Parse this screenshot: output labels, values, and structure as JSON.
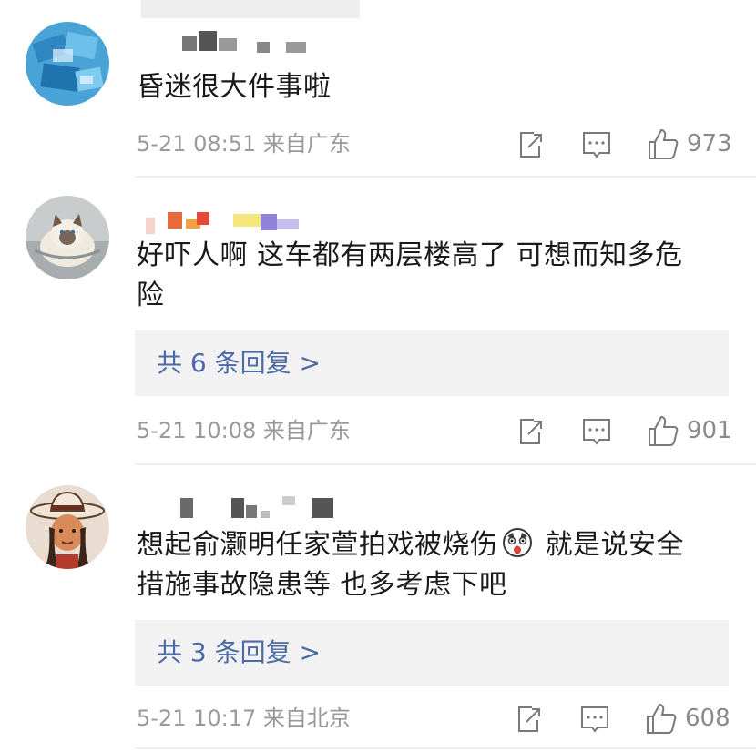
{
  "comments": [
    {
      "text": "昏迷很大件事啦",
      "text_line2": "",
      "replies_label": "",
      "time": "5-21 08:51 来自广东",
      "likes": "973",
      "avatar_icon": "blue-card-avatar"
    },
    {
      "text": "好吓人啊 这车都有两层楼高了 可想而知多危",
      "text_line2": "险",
      "replies_label": "共 6 条回复 >",
      "time": "5-21 10:08 来自广东",
      "likes": "901",
      "avatar_icon": "cat-avatar"
    },
    {
      "text_before_emoji": "想起俞灏明任家萱拍戏被烧伤",
      "text_after_emoji": " 就是说安全",
      "text_line2": "措施事故隐患等 也多考虑下吧",
      "emoji_icon": "shocked-face-emoji",
      "replies_label": "共 3 条回复 >",
      "time": "5-21 10:17 来自北京",
      "likes": "608",
      "avatar_icon": "cowboy-hat-avatar"
    }
  ],
  "icons": {
    "share": "share-icon",
    "comment": "comment-icon",
    "like": "thumbs-up-icon"
  },
  "colors": {
    "reply_link": "#4b6aa6",
    "meta_text": "#9a9a9a",
    "reply_box_bg": "#f2f2f2"
  }
}
